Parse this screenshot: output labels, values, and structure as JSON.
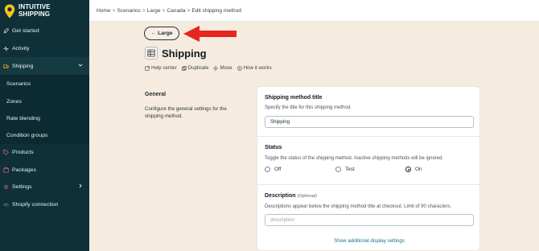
{
  "brand": {
    "line1": "INTUITIVE",
    "line2": "SHIPPING",
    "pin_color": "#f5c518"
  },
  "breadcrumb": [
    "Home",
    "Scenarios",
    "Large",
    "Canada",
    "Edit shipping method"
  ],
  "breadcrumb_separator": ">",
  "sidebar": {
    "items": [
      {
        "label": "Get started",
        "icon": "rocket-icon"
      },
      {
        "label": "Activity",
        "icon": "activity-icon"
      },
      {
        "label": "Shipping",
        "icon": "shipping-icon",
        "expanded": true
      },
      {
        "label": "Scenarios"
      },
      {
        "label": "Zones"
      },
      {
        "label": "Rate blending"
      },
      {
        "label": "Condition groups"
      },
      {
        "label": "Products",
        "icon": "tag-icon"
      },
      {
        "label": "Packages",
        "icon": "package-icon"
      },
      {
        "label": "Settings",
        "icon": "gear-icon"
      },
      {
        "label": "Shopify connection",
        "icon": "connection-icon"
      }
    ]
  },
  "back_button": {
    "label": "Large",
    "arrow": "←"
  },
  "page": {
    "title": "Shipping",
    "icon": "table-icon"
  },
  "actions": [
    {
      "label": "Help center",
      "icon": "external-link-icon"
    },
    {
      "label": "Duplicate",
      "icon": "duplicate-icon"
    },
    {
      "label": "Move",
      "icon": "move-icon"
    },
    {
      "label": "How it works",
      "icon": "play-icon"
    }
  ],
  "general": {
    "title": "General",
    "description": "Configure the general settings for the shipping method."
  },
  "form": {
    "title_label": "Shipping method title",
    "title_help": "Specify the title for this shipping method.",
    "title_value": "Shipping",
    "status_label": "Status",
    "status_help": "Toggle the status of the shipping method. Inactive shipping methods will be ignored.",
    "status_options": [
      "Off",
      "Test",
      "On"
    ],
    "status_selected": "On",
    "description_label": "Description",
    "description_optional": "(Optional)",
    "description_help": "Descriptions appear below the shipping method title at checkout. Limit of 90 characters.",
    "description_placeholder": "description",
    "show_more_link": "Show additional display settings"
  },
  "colors": {
    "sidebar_bg": "#0f3038",
    "page_bg": "#f5ecdf",
    "annotation_arrow": "#e8251f",
    "link": "#1e6d96"
  }
}
